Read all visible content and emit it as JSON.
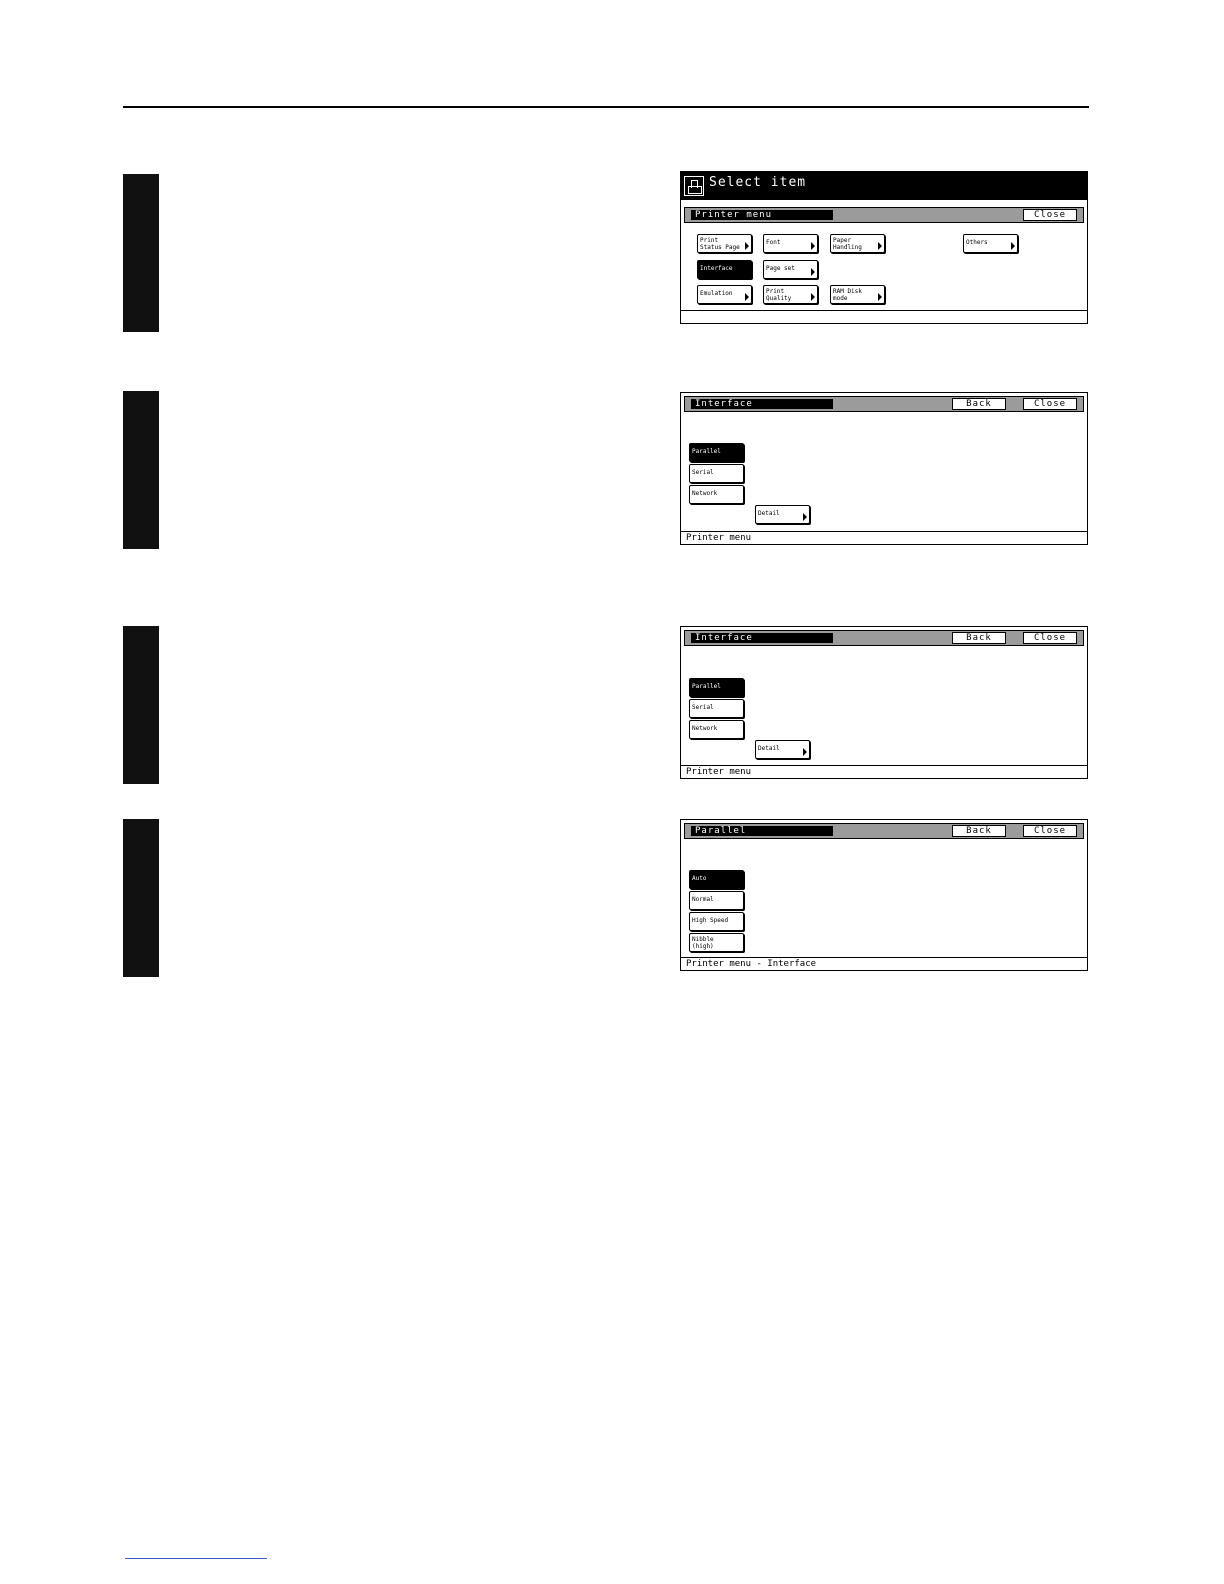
{
  "screens": {
    "printer_menu": {
      "window_title": "Select item",
      "heading": "Printer menu",
      "close_label": "Close",
      "items": [
        {
          "label": "Print\nStatus Page"
        },
        {
          "label": "Font"
        },
        {
          "label": "Paper\nHandling"
        },
        {
          "label": "Others"
        },
        {
          "label": "Interface"
        },
        {
          "label": "Page set"
        },
        {
          "label": "Emulation"
        },
        {
          "label": "Print\nQuality"
        },
        {
          "label": "RAM Disk\nmode"
        }
      ],
      "path": ""
    },
    "interface_1": {
      "heading": "Interface",
      "back_label": "Back",
      "close_label": "Close",
      "options": [
        "Parallel",
        "Serial",
        "Network"
      ],
      "detail_label": "Detail",
      "path": "Printer menu"
    },
    "interface_2": {
      "heading": "Interface",
      "back_label": "Back",
      "close_label": "Close",
      "options": [
        "Parallel",
        "Serial",
        "Network"
      ],
      "detail_label": "Detail",
      "path": "Printer menu"
    },
    "parallel": {
      "heading": "Parallel",
      "back_label": "Back",
      "close_label": "Close",
      "options": [
        "Auto",
        "Normal",
        "High Speed",
        "Nibble\n(high)"
      ],
      "path": "Printer menu - Interface"
    }
  }
}
